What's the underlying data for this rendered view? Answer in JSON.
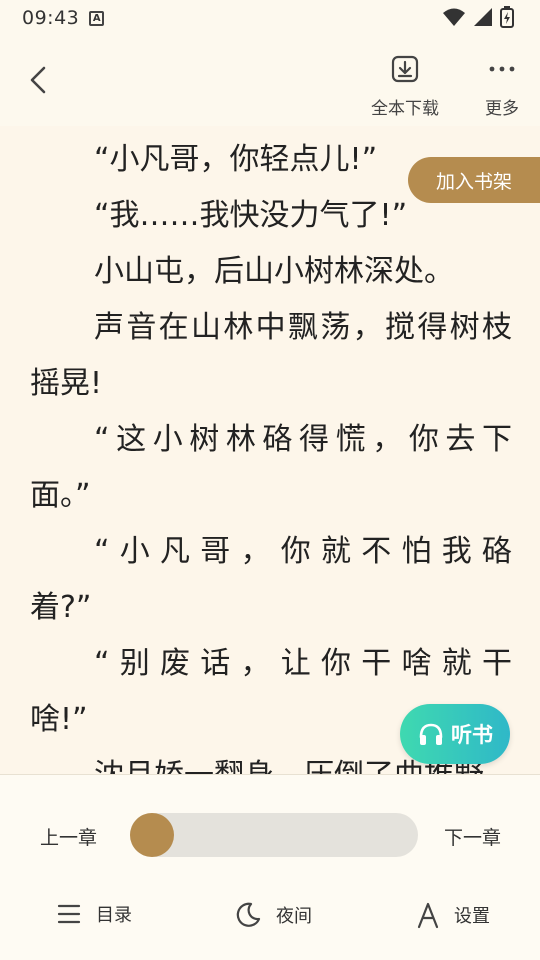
{
  "status_bar": {
    "time": "09:43",
    "badge": "A"
  },
  "toolbar": {
    "download_label": "全本下载",
    "more_label": "更多"
  },
  "content": {
    "paragraphs": [
      "“小凡哥，你轻点儿!”",
      "“我……我快没力气了!”",
      "小山屯，后山小树林深处。",
      "声音在山林中飘荡，搅得树枝",
      "摇晃!",
      "“这小树林硌得慌，你去下",
      "面。”",
      "“小凡哥，你就不怕我硌",
      "着?”",
      "“别废话，让你干啥就干",
      "啥!”",
      "沈月娇一翻身，压倒了曲推野"
    ]
  },
  "floating": {
    "add_shelf": "加入书架",
    "listen": "听书"
  },
  "bottom": {
    "prev_chapter": "上一章",
    "next_chapter": "下一章",
    "progress": 0.0,
    "nav": {
      "menu": "目录",
      "night": "夜间",
      "settings": "设置"
    }
  },
  "colors": {
    "accent": "#b58c4f",
    "listen_gradient_start": "#3fd9b0",
    "listen_gradient_end": "#2fb8c8",
    "page_bg": "#fdf6ea"
  }
}
